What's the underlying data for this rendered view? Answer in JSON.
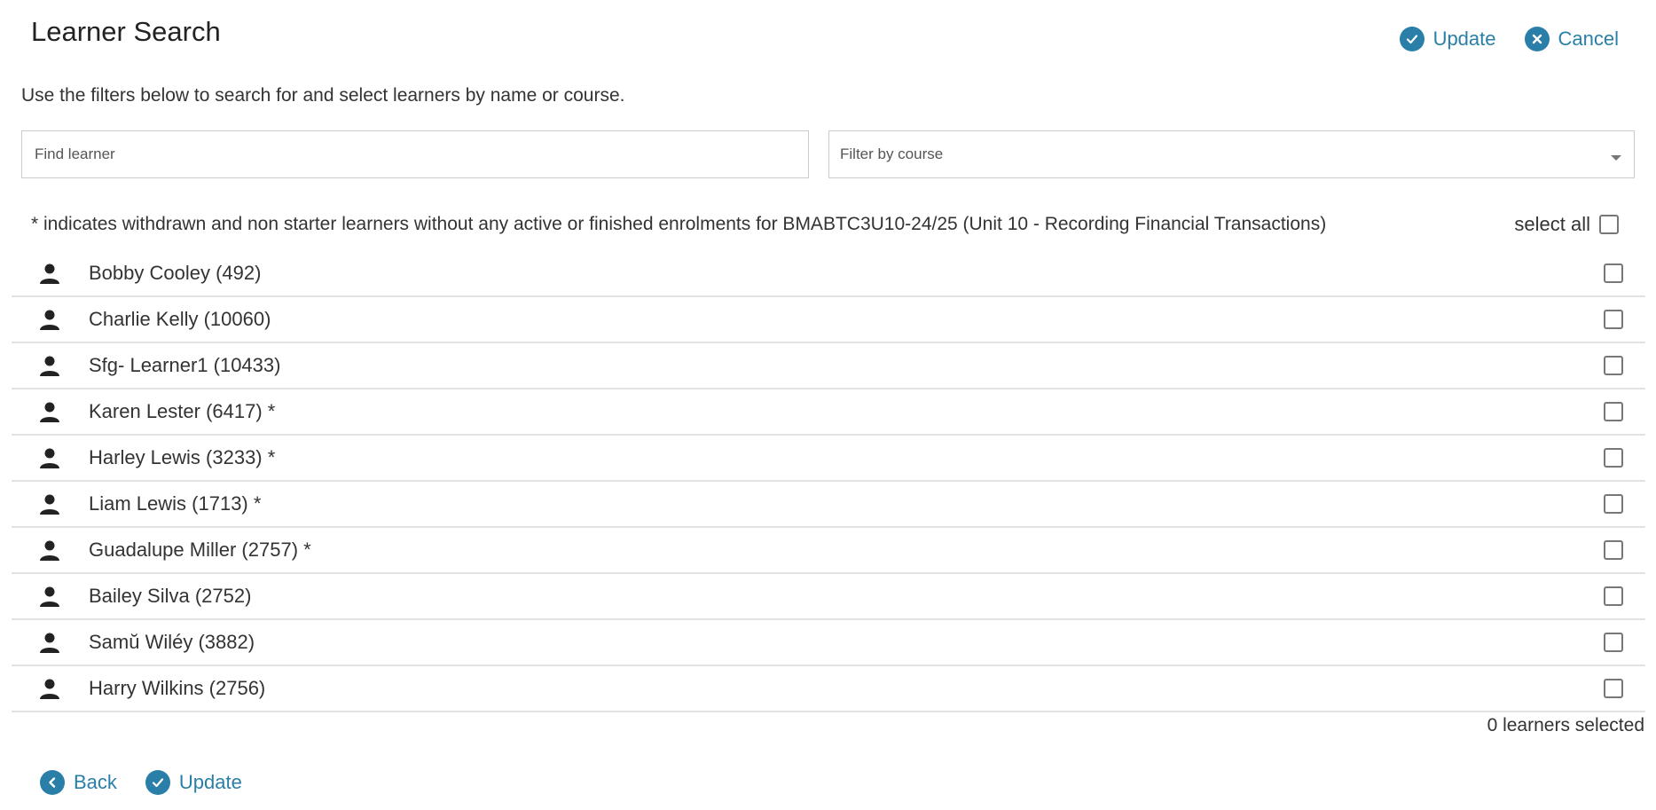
{
  "header": {
    "title": "Learner Search",
    "actions": [
      {
        "label": "Update",
        "icon": "check-circle-icon"
      },
      {
        "label": "Cancel",
        "icon": "close-circle-icon"
      }
    ]
  },
  "intro": "Use the filters below to search for and select learners by name or course.",
  "filters": {
    "learner_placeholder": "Find learner",
    "learner_value": "",
    "course_placeholder": "Filter by course",
    "course_value": ""
  },
  "note": "* indicates withdrawn and non starter learners without any active or finished enrolments for BMABTC3U10-24/25 (Unit 10 - Recording Financial Transactions)",
  "select_all_label": "select all",
  "select_all_checked": false,
  "learners": [
    {
      "name": "Bobby Cooley (492)",
      "checked": false
    },
    {
      "name": "Charlie Kelly (10060)",
      "checked": false
    },
    {
      "name": "Sfg- Learner1 (10433)",
      "checked": false
    },
    {
      "name": "Karen Lester (6417) *",
      "checked": false
    },
    {
      "name": "Harley Lewis (3233) *",
      "checked": false
    },
    {
      "name": "Liam Lewis (1713) *",
      "checked": false
    },
    {
      "name": "Guadalupe Miller (2757) *",
      "checked": false
    },
    {
      "name": "Bailey Silva (2752)",
      "checked": false
    },
    {
      "name": "Samŭ Wiléy (3882)",
      "checked": false
    },
    {
      "name": "Harry Wilkins (2756)",
      "checked": false
    }
  ],
  "selected_count_text": "0 learners selected",
  "footer": {
    "actions": [
      {
        "label": "Back",
        "icon": "chevron-left-circle-icon"
      },
      {
        "label": "Update",
        "icon": "check-circle-icon"
      }
    ]
  },
  "colors": {
    "accent": "#2a7fa8",
    "text": "#333333",
    "divider": "#e2e2e2"
  }
}
